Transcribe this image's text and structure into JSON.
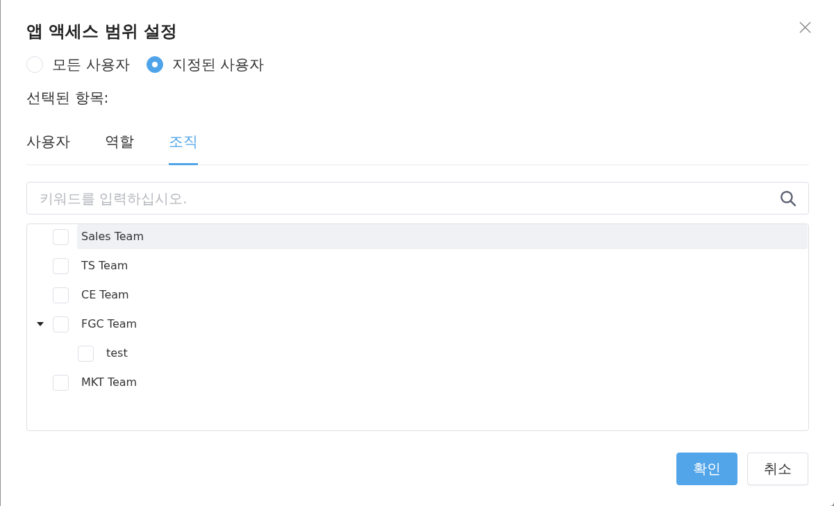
{
  "dialog": {
    "title": "앱 액세스 범위 설정",
    "scope_options": [
      {
        "label": "모든 사용자",
        "selected": false
      },
      {
        "label": "지정된 사용자",
        "selected": true
      }
    ],
    "selected_label": "선택된 항목:",
    "tabs": [
      {
        "label": "사용자",
        "selected": false
      },
      {
        "label": "역할",
        "selected": false
      },
      {
        "label": "조직",
        "selected": true
      }
    ],
    "search": {
      "placeholder": "키워드를 입력하십시오."
    },
    "tree": {
      "items": [
        {
          "label": "Sales Team",
          "checked": false,
          "highlighted": true
        },
        {
          "label": "TS Team",
          "checked": false,
          "highlighted": false
        },
        {
          "label": "CE Team",
          "checked": false,
          "highlighted": false
        },
        {
          "label": "FGC Team",
          "checked": false,
          "expanded": true,
          "highlighted": false,
          "children": [
            {
              "label": "test",
              "checked": false,
              "highlighted": false
            }
          ]
        },
        {
          "label": "MKT Team",
          "checked": false,
          "highlighted": false
        }
      ]
    },
    "buttons": [
      {
        "label": "확인",
        "kind": "primary"
      },
      {
        "label": "취소",
        "kind": "secondary"
      }
    ]
  }
}
